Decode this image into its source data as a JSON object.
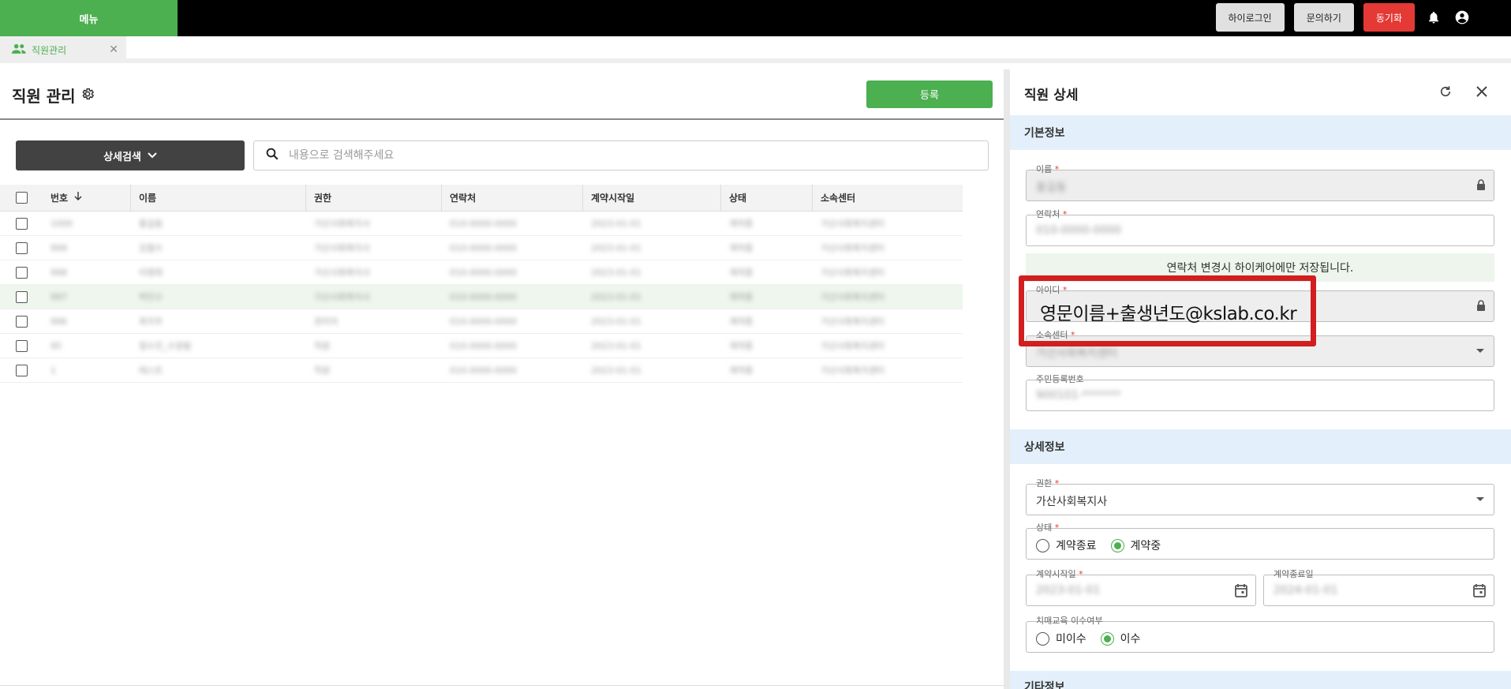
{
  "topbar": {
    "menu_label": "메뉴",
    "buttons": [
      "하이로그인",
      "문의하기",
      "동기화"
    ],
    "icons": [
      "bell-icon",
      "account-circle-icon"
    ]
  },
  "tab": {
    "label": "직원관리",
    "icon": "people-icon"
  },
  "page": {
    "title": "직원 관리",
    "register_label": "등록",
    "advanced_search_label": "상세검색",
    "search_placeholder": "내용으로 검색해주세요"
  },
  "table": {
    "headers": [
      "번호",
      "이름",
      "권한",
      "연락처",
      "계약시작일",
      "상태",
      "소속센터"
    ],
    "rows": [
      [
        "1000",
        "홍길동",
        "가산사회복지사",
        "010-0000-0000",
        "2023-01-01",
        "계약중",
        "가산사회복지센터"
      ],
      [
        "999",
        "김철수",
        "가산사회복지사",
        "010-0000-0000",
        "2023-01-01",
        "계약중",
        "가산사회복지센터"
      ],
      [
        "998",
        "이영희",
        "가산사회복지사",
        "010-0000-0000",
        "2023-01-01",
        "계약중",
        "가산사회복지센터"
      ],
      [
        "997",
        "박민수",
        "가산사회복지사",
        "010-0000-0000",
        "2023-01-01",
        "계약중",
        "가산사회복지센터"
      ],
      [
        "996",
        "최지우",
        "관리자",
        "010-0000-0000",
        "2023-01-01",
        "계약중",
        "가산사회복지센터"
      ],
      [
        "95",
        "정수진_수정됨",
        "직원",
        "010-0000-0000",
        "2023-01-01",
        "계약중",
        "가산사회복지센터"
      ],
      [
        "1",
        "테스트",
        "직원",
        "010-0000-0000",
        "2023-01-01",
        "계약중",
        "가산사회복지센터"
      ]
    ]
  },
  "detail": {
    "title": "직원 상세",
    "basic_section": "기본정보",
    "name_label": "이름",
    "name_value": "홍길동",
    "phone_label": "연락처",
    "phone_value": "010-0000-0000",
    "notice": "연락처 변경시 하이케어에만 저장됩니다.",
    "id_label": "아이디",
    "center_label": "소속센터",
    "center_value": "가산사회복지센터",
    "rrn_label": "주민등록번호",
    "rrn_value": "900101-*******",
    "detail_section": "상세정보",
    "role_label": "권한",
    "role_value": "가산사회복지사",
    "status_label": "상태",
    "status_options": [
      "계약종료",
      "계약중"
    ],
    "status_selected": "계약중",
    "start_label": "계약시작일",
    "start_value": "2023-01-01",
    "end_label": "계약종료일",
    "end_value": "2024-01-01",
    "edu_label": "치매교육 이수여부",
    "edu_options": [
      "미이수",
      "이수"
    ],
    "edu_selected": "이수",
    "other_section": "기타정보"
  },
  "annotation": {
    "id_example": "영문이름+출생년도@kslab.co.kr",
    "highlight_color": "#d21e1e"
  },
  "colors": {
    "primary": "#4caf50",
    "danger": "#e53935",
    "section_bg": "#e3f0fb"
  }
}
